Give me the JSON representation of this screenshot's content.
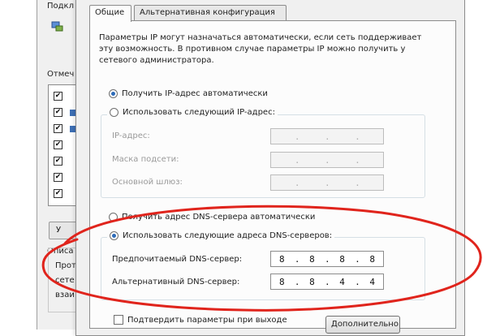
{
  "back_window": {
    "label_top": "Подкл",
    "label_list": "Отмеч",
    "label_group": "Описа",
    "group_text_1": "Прот",
    "group_text_2": "сете",
    "group_text_3": "взаи",
    "button_label": "У",
    "check_mark": "✔"
  },
  "dialog": {
    "tabs": [
      {
        "label": "Общие",
        "active": true
      },
      {
        "label": "Альтернативная конфигурация",
        "active": false
      }
    ],
    "intro": "Параметры IP могут назначаться автоматически, если сеть поддерживает эту возможность. В противном случае параметры IP можно получить у сетевого администратора.",
    "ip_auto_label": "Получить IP-адрес автоматически",
    "ip_manual_label": "Использовать следующий IP-адрес:",
    "ip_fields": [
      {
        "label": "IP-адрес:"
      },
      {
        "label": "Маска подсети:"
      },
      {
        "label": "Основной шлюз:"
      }
    ],
    "dns_auto_label": "Получить адрес DNS-сервера автоматически",
    "dns_manual_label": "Использовать следующие адреса DNS-серверов:",
    "dns_fields": [
      {
        "label": "Предпочитаемый DNS-сервер:",
        "octets": [
          "8",
          "8",
          "8",
          "8"
        ]
      },
      {
        "label": "Альтернативный DNS-сервер:",
        "octets": [
          "8",
          "8",
          "4",
          "4"
        ]
      }
    ],
    "validate_label": "Подтвердить параметры при выходе",
    "advanced_button": "Дополнительно..."
  },
  "highlight": {
    "color": "#e0241c"
  }
}
